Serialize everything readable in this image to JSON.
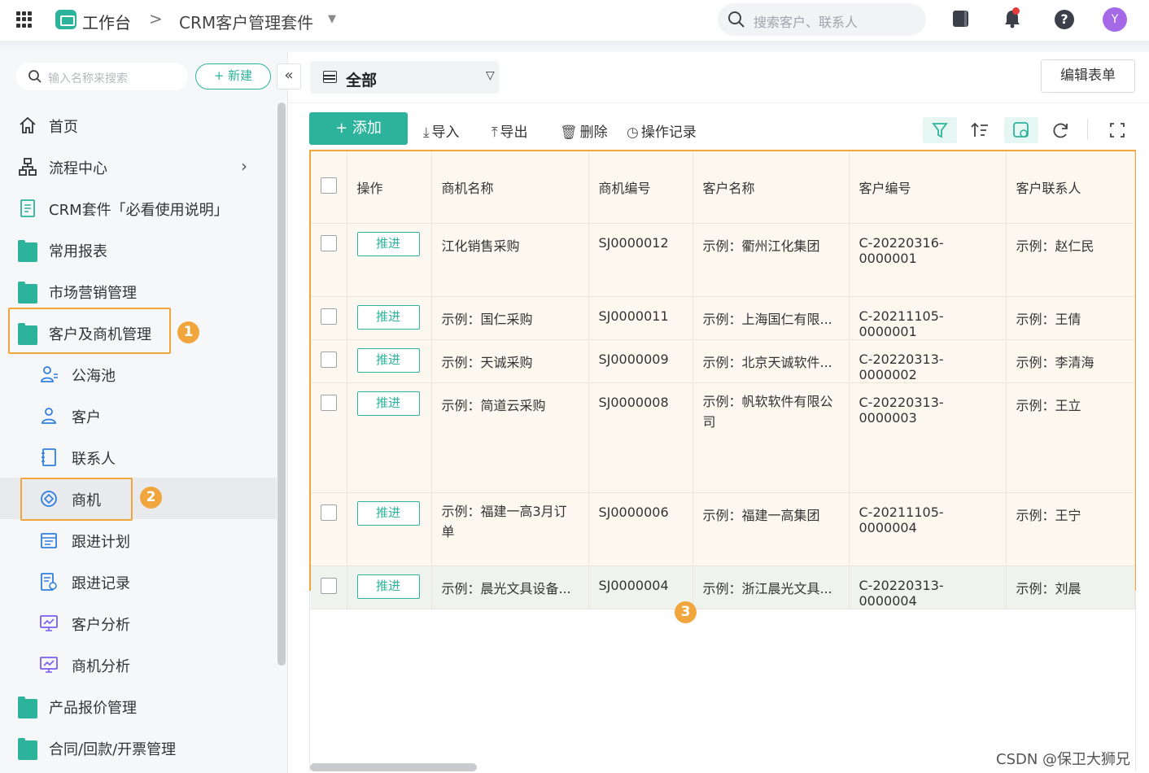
{
  "topbar": {
    "brand_title": "工作台",
    "breadcrumb_sep": ">",
    "app_name": "CRM客户管理套件",
    "search_placeholder": "搜索客户、联系人",
    "avatar_initial": "Y",
    "help_label": "?",
    "icons": [
      "apps-grid-icon",
      "workbench-icon",
      "book-icon",
      "bell-icon",
      "help-icon"
    ],
    "accent_color": "#2db39c",
    "notification_color": "#e63b3b",
    "avatar_color": "#a569e8"
  },
  "sidebar": {
    "search_placeholder": "输入名称来搜索",
    "new_label": "+ 新建",
    "collapse_label": "«",
    "items": [
      {
        "label": "首页",
        "icon": "home-icon"
      },
      {
        "label": "流程中心",
        "icon": "flow-icon"
      },
      {
        "label": "CRM套件「必看使用说明」",
        "icon": "document-icon"
      },
      {
        "label": "常用报表",
        "icon": "folder-icon"
      },
      {
        "label": "市场营销管理",
        "icon": "folder-icon"
      },
      {
        "label": "客户及商机管理",
        "icon": "folder-icon"
      },
      {
        "label": "公海池",
        "icon": "users-icon"
      },
      {
        "label": "客户",
        "icon": "user-icon"
      },
      {
        "label": "联系人",
        "icon": "contact-book-icon"
      },
      {
        "label": "商机",
        "icon": "opportunity-icon"
      },
      {
        "label": "跟进计划",
        "icon": "calendar-icon"
      },
      {
        "label": "跟进记录",
        "icon": "record-icon"
      },
      {
        "label": "客户分析",
        "icon": "chart-screen-icon"
      },
      {
        "label": "商机分析",
        "icon": "chart-screen-icon"
      },
      {
        "label": "产品报价管理",
        "icon": "folder-icon"
      },
      {
        "label": "合同/回款/开票管理",
        "icon": "folder-icon"
      }
    ],
    "active_item": "商机"
  },
  "annotations": {
    "badge1": "1",
    "badge2": "2",
    "badge3": "3",
    "color": "#f0a63c"
  },
  "main": {
    "view_label": "全部",
    "edit_form_label": "编辑表单",
    "toolbar": {
      "add_label": "+ 添加",
      "import_label": "导入",
      "export_label": "导出",
      "delete_label": "删除",
      "history_label": "操作记录"
    },
    "table": {
      "headers": [
        "操作",
        "商机名称",
        "商机编号",
        "客户名称",
        "客户编号",
        "客户联系人"
      ],
      "action_label": "推进",
      "rows": [
        {
          "name": "江化销售采购",
          "code": "SJ0000012",
          "customer": "示例：衢州江化集团",
          "customer_code": "C-20220316-0000001",
          "contact": "示例：赵仁民"
        },
        {
          "name": "示例：国仁采购",
          "code": "SJ0000011",
          "customer": "示例：上海国仁有限...",
          "customer_code": "C-20211105-0000001",
          "contact": "示例：王倩"
        },
        {
          "name": "示例：天诚采购",
          "code": "SJ0000009",
          "customer": "示例：北京天诚软件...",
          "customer_code": "C-20220313-0000002",
          "contact": "示例：李清海"
        },
        {
          "name": "示例：简道云采购",
          "code": "SJ0000008",
          "customer": "示例：帆软软件有限公司",
          "customer_code": "C-20220313-0000003",
          "contact": "示例：王立"
        },
        {
          "name": "示例：福建一高3月订单",
          "code": "SJ0000006",
          "customer": "示例：福建一高集团",
          "customer_code": "C-20211105-0000004",
          "contact": "示例：王宁"
        },
        {
          "name": "示例：晨光文具设备...",
          "code": "SJ0000004",
          "customer": "示例：浙江晨光文具...",
          "customer_code": "C-20220313-0000004",
          "contact": "示例：刘晨"
        }
      ]
    }
  },
  "watermark": "CSDN @保卫大狮兄"
}
